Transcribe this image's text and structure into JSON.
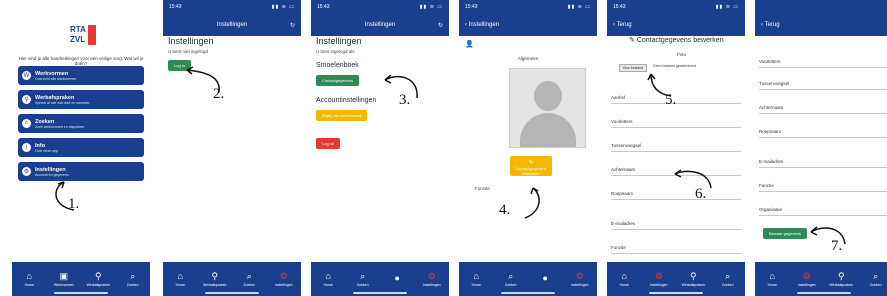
{
  "colors": {
    "nav": "#1b3f8f",
    "green": "#2e8b57",
    "yellow": "#f5b800",
    "red": "#e53935"
  },
  "status": {
    "time": "15:43",
    "icons": "▮▮ ≋ ▭"
  },
  "tabs": [
    {
      "icon": "home-icon",
      "glyph": "⌂",
      "label": "Home"
    },
    {
      "icon": "document-icon",
      "glyph": "▣",
      "label": "Werkvormen"
    },
    {
      "icon": "user-search-icon",
      "glyph": "⚲",
      "label": "Werkafspraken"
    },
    {
      "icon": "search-icon",
      "glyph": "⌕",
      "label": "Zoeken"
    },
    {
      "icon": "settings-icon",
      "glyph": "⚙",
      "label": "Instellingen"
    }
  ],
  "screen1": {
    "logo_line1": "RTA",
    "logo_line2": "ZVL",
    "welcome": "Hier vind je alle handreikingen voor een veilige zorg. Wat wil je doen?",
    "menu": [
      {
        "icon": "W",
        "title": "Werkvormen",
        "sub": "Overzicht alle werkvormen"
      },
      {
        "icon": "⚲",
        "title": "Werkafspraken",
        "sub": "Spreek af wie wat doet en wanneer"
      },
      {
        "icon": "⌕",
        "title": "Zoeken",
        "sub": "Zoek werkvormen en afspraken"
      },
      {
        "icon": "i",
        "title": "Info",
        "sub": "Over deze app"
      },
      {
        "icon": "⚙",
        "title": "Instellingen",
        "sub": "Account en gegevens"
      }
    ],
    "step": "1."
  },
  "screen2": {
    "nav_title": "Instellingen",
    "title": "Instellingen",
    "text": "U bent niet ingelogd",
    "login": "Log in",
    "step": "2."
  },
  "screen3": {
    "nav_title": "Instellingen",
    "title": "Instellingen",
    "text": "U bent ingelogd als",
    "section1": "Smoelenboek",
    "contact_btn": "Contactgegevens",
    "section2": "Accountinstellingen",
    "password_btn": "Wijzig uw wachtwoord",
    "logout_btn": "Log uit",
    "step": "3."
  },
  "screen4": {
    "back": "Instellingen",
    "section": "Algemeen",
    "edit_btn": "Contactgegevens bewerken",
    "field": "Functie",
    "step": "4."
  },
  "screen5": {
    "back": "Terug",
    "title": "Contactgegevens bewerken",
    "photo": "Foto",
    "choose": "Kies bestand",
    "no_file": "Geen bestand geselecteerd",
    "fields": [
      "Aanhef",
      "Voorletters",
      "Tussenvoegsel",
      "Achternaam",
      "Roepnaam",
      "E-mailadres",
      "Functie"
    ],
    "step5": "5.",
    "step6": "6."
  },
  "screen6": {
    "back": "Terug",
    "fields": [
      "Voorletters",
      "Tussenvoegsel",
      "Achternaam",
      "Roepnaam",
      "E-mailadres",
      "Functie",
      "Organisatie"
    ],
    "save": "Bewaar gegevens",
    "step": "7."
  }
}
